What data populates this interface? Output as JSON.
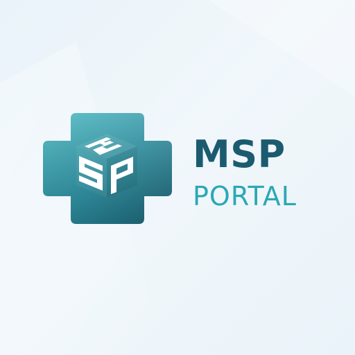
{
  "brand": {
    "name": "MSP",
    "tagline": "PORTAL",
    "emblem_letters": "MSP",
    "colors": {
      "primary_dark": "#1b5b6f",
      "accent_teal": "#2aa8b6",
      "cross_light": "#3bb3bd",
      "cross_dark": "#1f6f83",
      "background": "#eef5fa"
    }
  },
  "emblem": {
    "icon": "medical-cross-cube-icon"
  }
}
